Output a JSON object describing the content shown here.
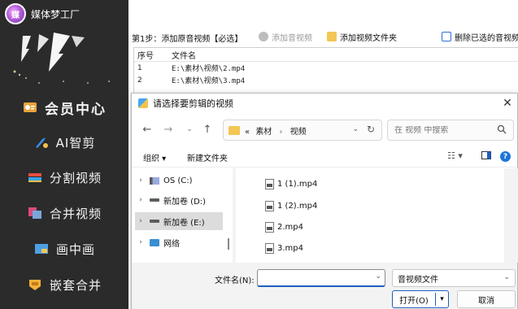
{
  "app": {
    "name": "媒体梦工厂",
    "logo_text": "媒"
  },
  "sidebar": {
    "items": [
      {
        "label": "会员中心",
        "icon": "member-badge-icon"
      },
      {
        "label": "AI智剪",
        "icon": "ai-scissors-icon"
      },
      {
        "label": "分割视频",
        "icon": "split-video-icon"
      },
      {
        "label": "合并视频",
        "icon": "merge-video-icon"
      },
      {
        "label": "画中画",
        "icon": "picture-in-picture-icon"
      },
      {
        "label": "嵌套合并",
        "icon": "nested-merge-icon"
      }
    ]
  },
  "toolbar": {
    "step_label": "第1步：添加原音视频【必选】",
    "add_audio_label": "添加音视频",
    "add_folder_label": "添加视频文件夹",
    "delete_selected_label": "删除已选的音视频"
  },
  "file_table": {
    "headers": [
      "序号",
      "文件名"
    ],
    "rows": [
      {
        "index": "1",
        "name": "E:\\素材\\视频\\2.mp4"
      },
      {
        "index": "2",
        "name": "E:\\素材\\视频\\3.mp4"
      }
    ]
  },
  "dialog": {
    "title": "请选择要剪辑的视频",
    "close_glyph": "✕",
    "breadcrumb_prefix": "«",
    "breadcrumb": [
      "素材",
      "视频"
    ],
    "search_placeholder": "在 视频 中搜索",
    "organize_label": "组织 ▾",
    "new_folder_label": "新建文件夹",
    "help_glyph": "?",
    "nav_pane": [
      {
        "label": "OS (C:)",
        "icon": "os-drive-icon"
      },
      {
        "label": "新加卷 (D:)",
        "icon": "drive-icon"
      },
      {
        "label": "新加卷 (E:)",
        "icon": "drive-icon",
        "selected": true
      },
      {
        "label": "网络",
        "icon": "network-icon"
      }
    ],
    "files": [
      "1 (1).mp4",
      "1 (2).mp4",
      "2.mp4",
      "3.mp4"
    ],
    "filename_label": "文件名(N):",
    "filename_value": "",
    "file_type_value": "音视频文件",
    "open_label": "打开(O)",
    "cancel_label": "取消"
  }
}
